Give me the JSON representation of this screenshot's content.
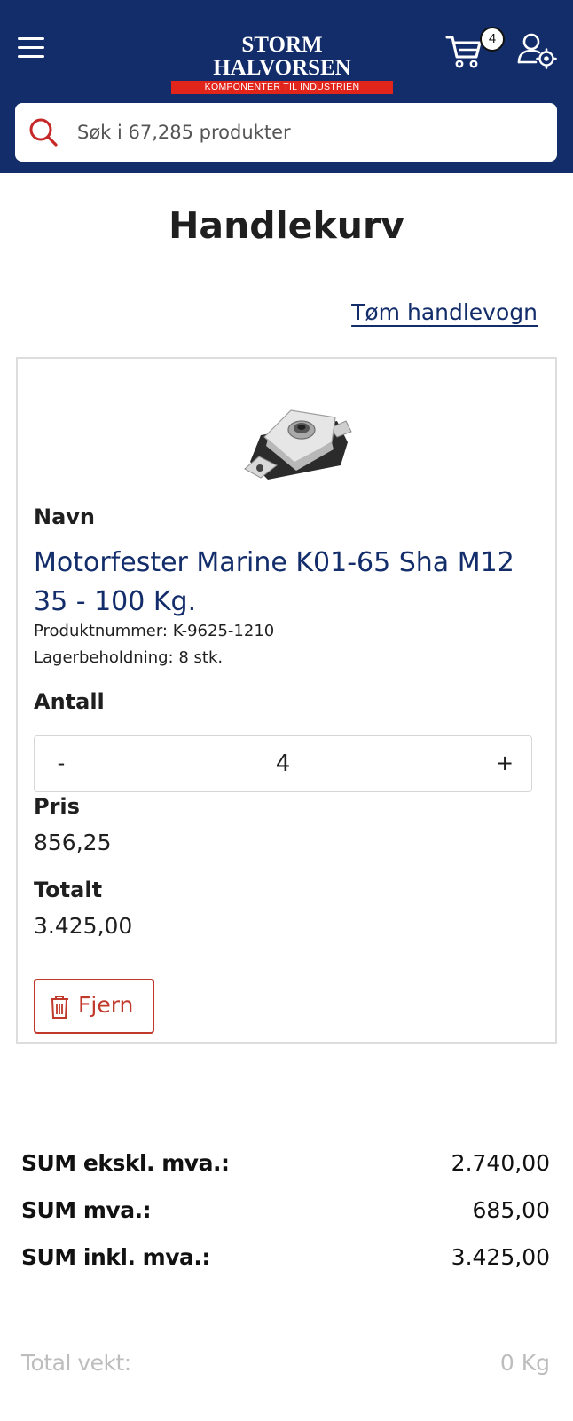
{
  "header": {
    "logo_title": "STORM HALVORSEN",
    "logo_tagline": "KOMPONENTER TIL INDUSTRIEN",
    "cart_count": "4",
    "search_placeholder": "Søk i 67,285 produkter",
    "colors": {
      "background": "#132d6b",
      "accent": "#e1251b"
    }
  },
  "page": {
    "title": "Handlekurv",
    "clear_cart_label": "Tøm handlevogn"
  },
  "cart_item": {
    "image_icon": "engine-mount-product-photo",
    "name_label": "Navn",
    "name": "Motorfester Marine K01-65 Sha M12 35 - 100 Kg.",
    "product_number": "Produktnummer: K-9625-1210",
    "stock": "Lagerbeholdning: 8 stk.",
    "quantity_label": "Antall",
    "quantity_minus": "-",
    "quantity": "4",
    "quantity_plus": "+",
    "price_label": "Pris",
    "price": "856,25",
    "total_label": "Totalt",
    "total": "3.425,00",
    "remove_label": "Fjern",
    "remove_icon": "trash-icon",
    "colors": {
      "link": "#132d6b",
      "danger": "#c0392b"
    }
  },
  "totals": {
    "sum_excl_label": "SUM ekskl. mva.:",
    "sum_excl": "2.740,00",
    "vat_label": "SUM mva.:",
    "vat": "685,00",
    "sum_incl_label": "SUM inkl. mva.:",
    "sum_incl": "3.425,00",
    "weight_label": "Total vekt:",
    "weight": "0 Kg"
  }
}
